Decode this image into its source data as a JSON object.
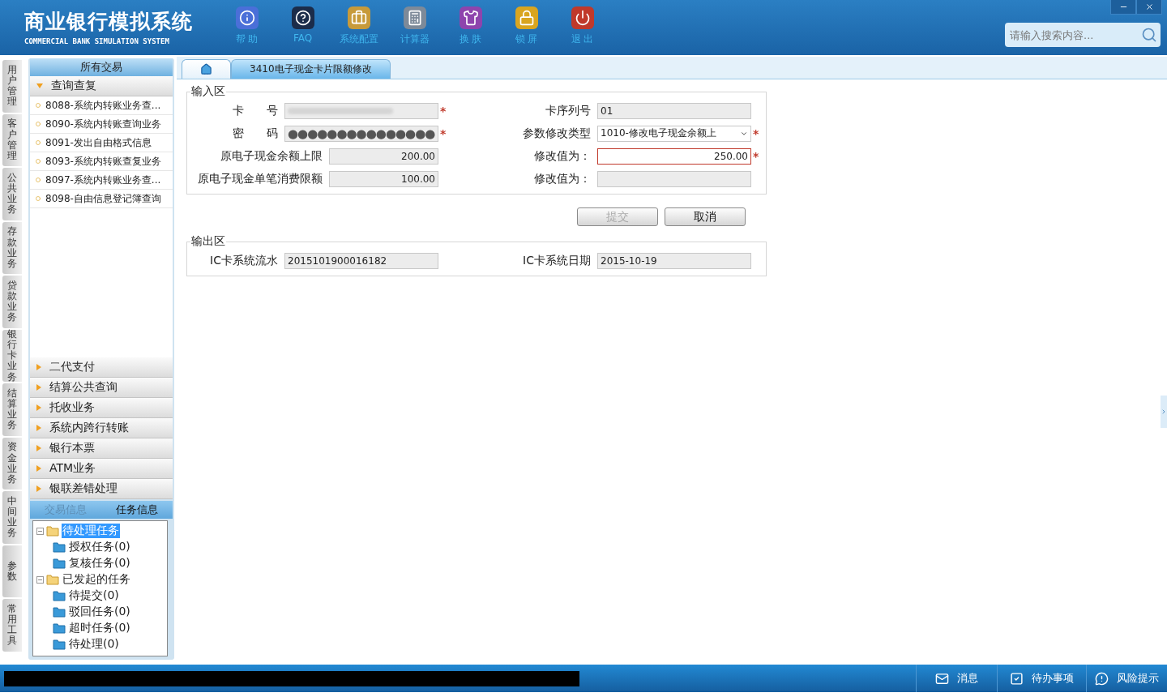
{
  "header": {
    "title": "商业银行模拟系统",
    "subtitle": "COMMERCIAL BANK SIMULATION SYSTEM",
    "tools": [
      {
        "kind": "help",
        "label": "帮 助"
      },
      {
        "kind": "faq",
        "label": "FAQ"
      },
      {
        "kind": "config",
        "label": "系统配置"
      },
      {
        "kind": "calculator",
        "label": "计算器"
      },
      {
        "kind": "skin",
        "label": "换 肤"
      },
      {
        "kind": "lock",
        "label": "锁 屏"
      },
      {
        "kind": "exit",
        "label": "退 出"
      }
    ],
    "search": {
      "placeholder": "请输入搜索内容..."
    }
  },
  "side_tabs": [
    "用户管理",
    "客户管理",
    "公共业务",
    "存款业务",
    "贷款业务",
    "银行卡业务",
    "结算业务",
    "资金业务",
    "中间业务",
    "参数",
    "常用工具"
  ],
  "sidebar": {
    "title": "所有交易",
    "groups": [
      {
        "label": "查询查复",
        "expanded": true,
        "items": [
          "8088-系统内转账业务查...",
          "8090-系统内转账查询业务",
          "8091-发出自由格式信息",
          "8093-系统内转账查复业务",
          "8097-系统内转账业务查...",
          "8098-自由信息登记簿查询"
        ]
      },
      {
        "label": "二代支付",
        "expanded": false
      },
      {
        "label": "结算公共查询",
        "expanded": false
      },
      {
        "label": "托收业务",
        "expanded": false
      },
      {
        "label": "系统内跨行转账",
        "expanded": false
      },
      {
        "label": "银行本票",
        "expanded": false
      },
      {
        "label": "ATM业务",
        "expanded": false
      },
      {
        "label": "银联差错处理",
        "expanded": false
      }
    ],
    "info_tabs": [
      {
        "label": "交易信息",
        "selected": false
      },
      {
        "label": "任务信息",
        "selected": true
      }
    ],
    "tree": [
      {
        "label": "待处理任务",
        "selected": true,
        "expanded": true,
        "children": [
          {
            "label": "授权任务(0)",
            "selected": false
          },
          {
            "label": "复核任务(0)",
            "selected": false
          }
        ]
      },
      {
        "label": "已发起的任务",
        "selected": false,
        "expanded": true,
        "children": [
          {
            "label": "待提交(0)",
            "selected": false
          },
          {
            "label": "驳回任务(0)",
            "selected": false
          },
          {
            "label": "超时任务(0)",
            "selected": false
          },
          {
            "label": "待处理(0)",
            "selected": false
          }
        ]
      }
    ]
  },
  "tabs": [
    {
      "kind": "home",
      "selected": false
    },
    {
      "kind": "page",
      "label": "3410电子现金卡片限额修改",
      "selected": true
    }
  ],
  "input_area": {
    "title": "输入区",
    "left": [
      {
        "label": "卡　　号",
        "kind": "masked",
        "mark": "*",
        "readonly": true,
        "focused": false
      },
      {
        "label": "密　　码",
        "kind": "password",
        "value": "●●●●●●●●●●●●●●●",
        "mark": "*",
        "readonly": true,
        "focused": false
      },
      {
        "label": "原电子现金余额上限",
        "kind": "amount",
        "value": "200.00",
        "readonly": true,
        "focused": false
      },
      {
        "label": "原电子现金单笔消费限额",
        "kind": "amount",
        "value": "100.00",
        "readonly": true,
        "focused": false
      }
    ],
    "right": [
      {
        "label": "卡序列号",
        "kind": "text",
        "value": "01",
        "readonly": true,
        "focused": false
      },
      {
        "label": "参数修改类型",
        "kind": "select",
        "value": "1010-修改电子现金余额上",
        "mark": "*",
        "readonly": false,
        "focused": false
      },
      {
        "label": "修改值为：",
        "kind": "amount",
        "value": "250.00",
        "mark": "*",
        "readonly": false,
        "focused": true
      },
      {
        "label": "修改值为：",
        "kind": "text",
        "readonly": true,
        "focused": false
      }
    ]
  },
  "buttons": [
    {
      "label": "提交",
      "disabled": true
    },
    {
      "label": "取消",
      "disabled": false
    }
  ],
  "output_area": {
    "title": "输出区",
    "fields": [
      {
        "label": "IC卡系统流水",
        "value": "2015101900016182"
      },
      {
        "label": "IC卡系统日期",
        "value": "2015-10-19"
      }
    ]
  },
  "status_bar": [
    {
      "kind": "message",
      "label": "消息"
    },
    {
      "kind": "todo",
      "label": "待办事项"
    },
    {
      "kind": "risk",
      "label": "风险提示"
    }
  ]
}
